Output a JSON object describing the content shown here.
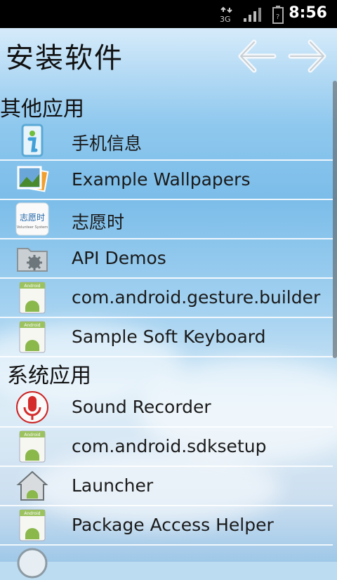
{
  "status_bar": {
    "network": "3G",
    "time": "8:56"
  },
  "header": {
    "title": "安装软件"
  },
  "sections": [
    {
      "title": "其他应用",
      "apps": [
        {
          "label": "手机信息",
          "icon": "phone-info-icon"
        },
        {
          "label": "Example Wallpapers",
          "icon": "wallpapers-icon"
        },
        {
          "label": "志愿时",
          "icon": "volunteer-system-icon",
          "icon_text": "志愿时",
          "icon_subtext": "Volunteer System"
        },
        {
          "label": "API Demos",
          "icon": "folder-gear-icon"
        },
        {
          "label": "com.android.gesture.builder",
          "icon": "android-default-icon",
          "icon_text": "Android"
        },
        {
          "label": "Sample Soft Keyboard",
          "icon": "android-default-icon",
          "icon_text": "Android"
        }
      ]
    },
    {
      "title": "系统应用",
      "apps": [
        {
          "label": "Sound Recorder",
          "icon": "microphone-icon"
        },
        {
          "label": "com.android.sdksetup",
          "icon": "android-default-icon",
          "icon_text": "Android"
        },
        {
          "label": "Launcher",
          "icon": "launcher-home-icon"
        },
        {
          "label": "Package Access Helper",
          "icon": "android-default-icon",
          "icon_text": "Android"
        }
      ]
    }
  ],
  "colors": {
    "background_sky": "#8fc8ee",
    "status_bar": "#000000",
    "divider": "#ffffff"
  }
}
